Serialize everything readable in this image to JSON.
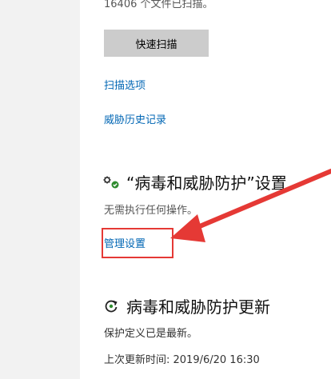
{
  "scan": {
    "status_text": "16406 个文件已扫描。",
    "quick_scan_label": "快速扫描",
    "scan_options_link": "扫描选项",
    "threat_history_link": "威胁历史记录"
  },
  "settings_section": {
    "icon": "gear-shield-icon",
    "title": "“病毒和威胁防护”设置",
    "status": "无需执行任何操作。",
    "manage_link": "管理设置"
  },
  "updates_section": {
    "icon": "refresh-icon",
    "title": "病毒和威胁防护更新",
    "status": "保护定义已是最新。",
    "last_update": "上次更新时间: 2019/6/20 16:30"
  },
  "colors": {
    "link": "#0066b4",
    "button_bg": "#cccccc",
    "annotation_red": "#e53935",
    "status_ok_green": "#2e8b2e"
  }
}
